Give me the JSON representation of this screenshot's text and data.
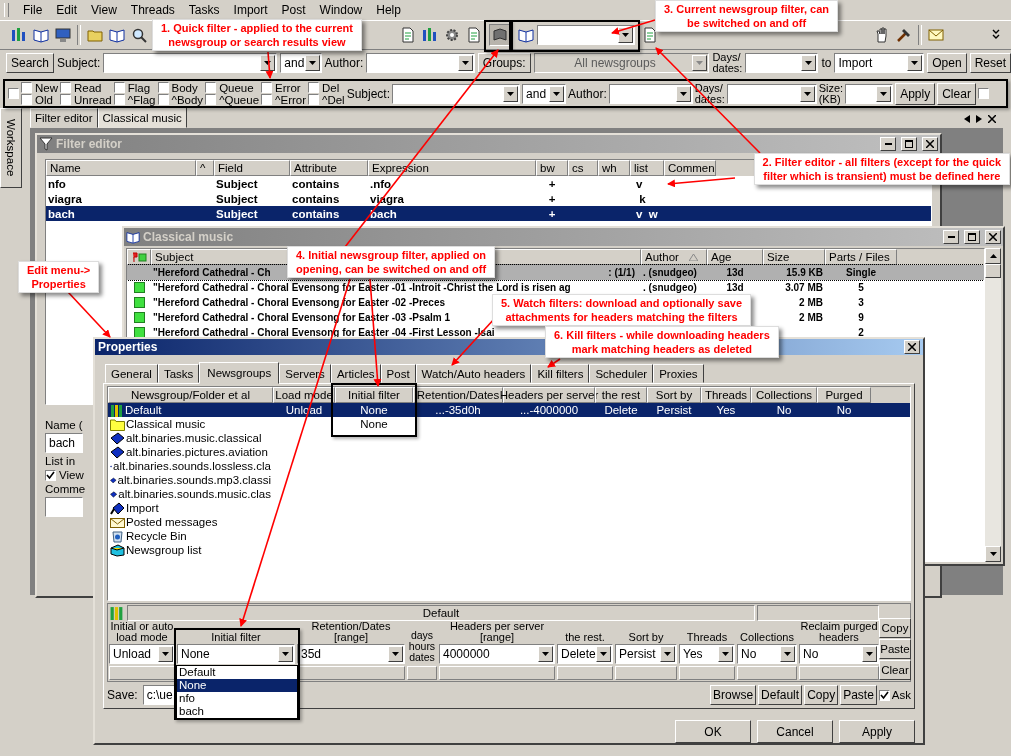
{
  "menu": [
    {
      "label": "File"
    },
    {
      "label": "Edit"
    },
    {
      "label": "View"
    },
    {
      "label": "Threads"
    },
    {
      "label": "Tasks"
    },
    {
      "label": "Import"
    },
    {
      "label": "Post"
    },
    {
      "label": "Window"
    },
    {
      "label": "Help"
    }
  ],
  "search_bar": {
    "button": "Search",
    "subject_label": "Subject:",
    "and": "and",
    "author_label": "Author:",
    "groups_button": "Groups:",
    "groups_value": "All newsgroups",
    "days_label": "Days/\ndates:",
    "to_label": "to",
    "target": "Import",
    "open": "Open",
    "reset": "Reset"
  },
  "quick_filter": {
    "lead_checked": false,
    "pairs": [
      {
        "top": {
          "label": "New",
          "checked": false
        },
        "bottom": {
          "label": "Old",
          "checked": false
        }
      },
      {
        "top": {
          "label": "Read",
          "checked": false
        },
        "bottom": {
          "label": "Unread",
          "checked": false
        }
      },
      {
        "top": {
          "label": "Flag",
          "checked": false
        },
        "bottom": {
          "label": "^Flag",
          "checked": false
        }
      },
      {
        "top": {
          "label": "Body",
          "checked": false
        },
        "bottom": {
          "label": "^Body",
          "checked": false
        }
      },
      {
        "top": {
          "label": "Queue",
          "checked": false
        },
        "bottom": {
          "label": "^Queue",
          "checked": false
        }
      },
      {
        "top": {
          "label": "Error",
          "checked": false
        },
        "bottom": {
          "label": "^Error",
          "checked": false
        }
      },
      {
        "top": {
          "label": "Del",
          "checked": false
        },
        "bottom": {
          "label": "^Del",
          "checked": false
        }
      }
    ],
    "subject_label": "Subject:",
    "and": "and",
    "author_label": "Author:",
    "days_label": "Days/\ndates:",
    "size_label": "Size:\n(KB)",
    "apply": "Apply",
    "clear": "Clear",
    "tail_checked": false
  },
  "workspace_tab": "Workspace",
  "document_tabs": [
    {
      "label": "Filter editor",
      "selected": false
    },
    {
      "label": "Classical music",
      "selected": true
    }
  ],
  "filter_editor": {
    "title": "Filter editor",
    "columns": [
      "Name",
      "^",
      "Field",
      "Attribute",
      "Expression",
      "bw",
      "cs",
      "wh",
      "list",
      "Commen"
    ],
    "rows": [
      {
        "name": "nfo",
        "field": "Subject",
        "attribute": "contains",
        "expression": ".nfo",
        "bw": "+",
        "list": "v",
        "selected": false
      },
      {
        "name": "viagra",
        "field": "Subject",
        "attribute": "contains",
        "expression": "viagra",
        "bw": "+",
        "list": " k",
        "selected": false
      },
      {
        "name": "bach",
        "field": "Subject",
        "attribute": "contains",
        "expression": "bach",
        "bw": "+",
        "list": "v  w",
        "selected": true
      }
    ],
    "name_label": "Name (",
    "name_value": "bach",
    "list_in_label": "List in",
    "view": {
      "label": "View",
      "checked": true
    },
    "comment_label": "Comme"
  },
  "classical_music": {
    "title": "Classical music",
    "columns": [
      "Subject",
      "Author",
      "Age",
      "Size",
      "Parts / Files"
    ],
    "rows": [
      {
        "subject": "\"Hereford Cathedral - Ch",
        "subject_tail": ": (1/1)",
        "author": ". (snudgeo)",
        "age": "13d",
        "size": "15.9 KB",
        "parts": "Single",
        "marked": false,
        "selected": true
      },
      {
        "subject": "\"Hereford Cathedral - Choral Evensong for Easter -01 -Introit -Christ the Lord is risen ag",
        "author": ". (snudgeo)",
        "age": "13d",
        "size": "3.07 MB",
        "parts": "5",
        "marked": true,
        "selected": false
      },
      {
        "subject": "\"Hereford Cathedral - Choral Evensong for Easter -02 -Preces",
        "size": "2 MB",
        "parts": "3",
        "marked": true,
        "selected": false
      },
      {
        "subject": "\"Hereford Cathedral - Choral Evensong for Easter -03 -Psalm 1",
        "size": "2 MB",
        "parts": "9",
        "marked": true,
        "selected": false
      },
      {
        "subject": "\"Hereford Cathedral - Choral Evensong for Easter -04 -First Lesson -Isai",
        "parts": "2",
        "marked": true,
        "selected": false
      }
    ]
  },
  "properties": {
    "title": "Properties",
    "tabs": [
      {
        "label": "General",
        "selected": false
      },
      {
        "label": "Tasks",
        "selected": false
      },
      {
        "label": "Newsgroups",
        "selected": true
      },
      {
        "label": "Servers",
        "selected": false
      },
      {
        "label": "Articles",
        "selected": false
      },
      {
        "label": "Post",
        "selected": false
      },
      {
        "label": "Watch/Auto headers",
        "selected": false
      },
      {
        "label": "Kill filters",
        "selected": false
      },
      {
        "label": "Scheduler",
        "selected": false
      },
      {
        "label": "Proxies",
        "selected": false
      }
    ],
    "columns": [
      "Newsgroup/Folder et al",
      "Load mode",
      "Initial filter",
      "Retention/Dates",
      "Headers per server",
      "the rest",
      "Sort by",
      "Threads",
      "Collections",
      "Purged"
    ],
    "rows": [
      {
        "kind": "root",
        "cells": [
          "Default",
          "Unload",
          "None",
          "...-35d0h",
          "...-4000000",
          "Delete",
          "Persist",
          "Yes",
          "No",
          "No"
        ],
        "selected": true
      },
      {
        "kind": "folder",
        "cells": [
          "Classical music",
          "",
          "None"
        ],
        "selected": false
      },
      {
        "kind": "newsgroup",
        "cells": [
          "alt.binaries.music.classical"
        ],
        "selected": false
      },
      {
        "kind": "newsgroup",
        "cells": [
          "alt.binaries.pictures.aviation"
        ],
        "selected": false
      },
      {
        "kind": "newsgroup",
        "cells": [
          "alt.binaries.sounds.lossless.cla"
        ],
        "selected": false
      },
      {
        "kind": "newsgroup",
        "cells": [
          "alt.binaries.sounds.mp3.classi"
        ],
        "selected": false
      },
      {
        "kind": "newsgroup",
        "cells": [
          "alt.binaries.sounds.music.clas"
        ],
        "selected": false
      },
      {
        "kind": "import",
        "cells": [
          "Import"
        ],
        "selected": false
      },
      {
        "kind": "mail",
        "cells": [
          "Posted messages"
        ],
        "selected": false
      },
      {
        "kind": "recycle",
        "cells": [
          "Recycle Bin"
        ],
        "selected": false
      },
      {
        "kind": "list",
        "cells": [
          "Newsgroup list"
        ],
        "selected": false
      }
    ],
    "panel_title": "Default",
    "fields": [
      {
        "label": "Initial or auto\nload mode",
        "value": "Unload"
      },
      {
        "label": "Initial filter",
        "value": "None"
      },
      {
        "label": "Retention/Dates [range]",
        "value": "35d"
      },
      {
        "label": "days\nhours\ndates"
      },
      {
        "label": "Headers per server [range]",
        "value": "4000000"
      },
      {
        "label": "the rest.",
        "value": "Delete"
      },
      {
        "label": "Sort by",
        "value": "Persist"
      },
      {
        "label": "Threads",
        "value": "Yes"
      },
      {
        "label": "Collections",
        "value": "No"
      },
      {
        "label": "Reclaim purged\nheaders",
        "value": "No"
      }
    ],
    "side_buttons": [
      "Copy",
      "Paste",
      "Clear"
    ],
    "filter_options": [
      {
        "label": "Default",
        "selected": false
      },
      {
        "label": "None",
        "selected": true
      },
      {
        "label": "nfo",
        "selected": false
      },
      {
        "label": "bach",
        "selected": false
      }
    ],
    "save_label": "Save:",
    "save_path": "c:\\ue",
    "save_buttons": [
      "Browse",
      "Default",
      "Copy",
      "Paste"
    ],
    "ask": {
      "label": "Ask",
      "checked": true
    },
    "buttons": [
      "OK",
      "Cancel",
      "Apply"
    ]
  },
  "annotations": [
    {
      "text": "1. Quick filter - applied to the current\nnewsgroup or search results view"
    },
    {
      "text": "2. Filter editor - all filters (except for the quick\nfilter which is transient) must be defined here"
    },
    {
      "text": "3. Current newsgroup filter, can\nbe switched on and off"
    },
    {
      "text": "4. Initial newsgroup filter, applied on\nopening, can be switched on and off"
    },
    {
      "text": "5. Watch filters: download and optionally save\nattachments for headers matching the filters"
    },
    {
      "text": "6. Kill filters - while downloading headers\nmark matching headers as deleted"
    },
    {
      "text": "Edit menu->\nProperties"
    }
  ]
}
